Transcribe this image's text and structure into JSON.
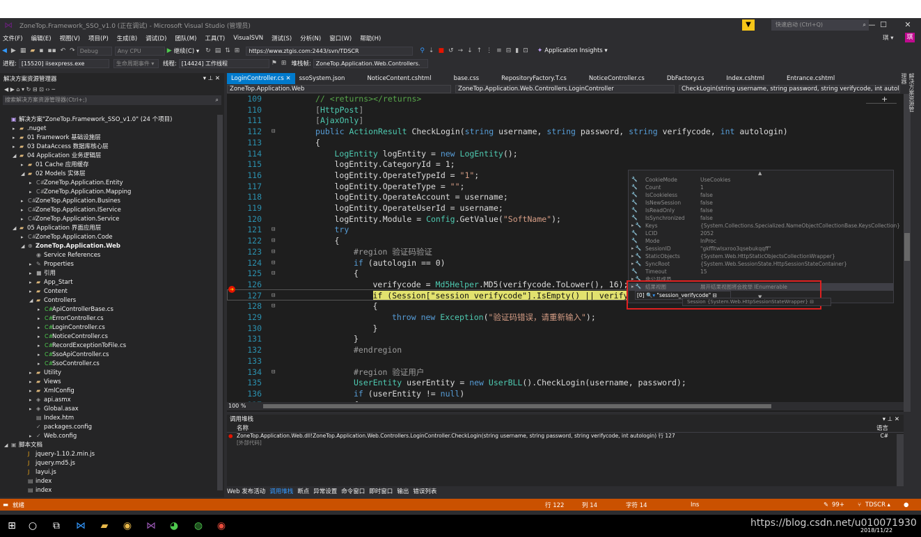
{
  "window": {
    "title": "ZoneTop.Framework_SSO_v1.0 (正在调试) - Microsoft Visual Studio (管理员)",
    "min": "—",
    "max": "☐",
    "close": "✕"
  },
  "quick_launch": {
    "placeholder": "快速启动 (Ctrl+Q)"
  },
  "user": {
    "name": "琪 ▾",
    "avatar": "琪"
  },
  "menu": [
    "文件(F)",
    "编辑(E)",
    "视图(V)",
    "项目(P)",
    "生成(B)",
    "调试(D)",
    "团队(M)",
    "工具(T)",
    "VisualSVN",
    "测试(S)",
    "分析(N)",
    "窗口(W)",
    "帮助(H)"
  ],
  "toolbar": {
    "config": "Debug",
    "platform": "Any CPU",
    "continue": "继续(C) ▾",
    "url": "https://www.ztgis.com:2443/svn/TDSCR",
    "insights": "Application Insights ▾"
  },
  "toolbar2": {
    "process_label": "进程:",
    "process": "[15520] iisexpress.exe",
    "lifecycle": "生命周期事件 ▾",
    "thread_label": "线程:",
    "thread": "[14424] 工作线程",
    "stack_label": "堆栈帧:",
    "stack": "ZoneTop.Application.Web.Controllers."
  },
  "solution": {
    "header": "解决方案资源管理器",
    "search": "搜索解决方案资源管理器(Ctrl+;)",
    "items": [
      {
        "label": "解决方案\"ZoneTop.Framework_SSO_v1.0\" (24 个项目)",
        "indent": 0,
        "icon": "▣",
        "arrow": "",
        "color": "#c5a5ff"
      },
      {
        "label": ".nuget",
        "indent": 1,
        "icon": "▰",
        "arrow": "▸",
        "color": "#dcb67a"
      },
      {
        "label": "01 Framework 基础设施层",
        "indent": 1,
        "icon": "▰",
        "arrow": "▸",
        "color": "#dcb67a"
      },
      {
        "label": "03 DataAccess 数据库核心层",
        "indent": 1,
        "icon": "▰",
        "arrow": "▸",
        "color": "#dcb67a"
      },
      {
        "label": "04 Application 业务逻辑层",
        "indent": 1,
        "icon": "▰",
        "arrow": "◢",
        "color": "#dcb67a"
      },
      {
        "label": "01 Cache 应用缓存",
        "indent": 2,
        "icon": "▰",
        "arrow": "▸",
        "color": "#dcb67a"
      },
      {
        "label": "02 Models 实体层",
        "indent": 2,
        "icon": "▰",
        "arrow": "◢",
        "color": "#dcb67a"
      },
      {
        "label": "ZoneTop.Application.Entity",
        "indent": 3,
        "icon": "C#",
        "arrow": "▸",
        "color": "#9b9b9b"
      },
      {
        "label": "ZoneTop.Application.Mapping",
        "indent": 3,
        "icon": "C#",
        "arrow": "▸",
        "color": "#9b9b9b"
      },
      {
        "label": "ZoneTop.Application.Busines",
        "indent": 2,
        "icon": "C#",
        "arrow": "▸",
        "color": "#9b9b9b"
      },
      {
        "label": "ZoneTop.Application.IService",
        "indent": 2,
        "icon": "C#",
        "arrow": "▸",
        "color": "#9b9b9b"
      },
      {
        "label": "ZoneTop.Application.Service",
        "indent": 2,
        "icon": "C#",
        "arrow": "▸",
        "color": "#9b9b9b"
      },
      {
        "label": "05 Application 界面应用层",
        "indent": 1,
        "icon": "▰",
        "arrow": "◢",
        "color": "#dcb67a"
      },
      {
        "label": "ZoneTop.Application.Code",
        "indent": 2,
        "icon": "C#",
        "arrow": "▸",
        "color": "#9b9b9b"
      },
      {
        "label": "ZoneTop.Application.Web",
        "indent": 2,
        "icon": "⊕",
        "arrow": "◢",
        "color": "#9b9b9b",
        "bold": true
      },
      {
        "label": "Service References",
        "indent": 3,
        "icon": "◉",
        "arrow": "",
        "color": "#9b9b9b"
      },
      {
        "label": "Properties",
        "indent": 3,
        "icon": "✎",
        "arrow": "▸",
        "color": "#9b9b9b"
      },
      {
        "label": "引用",
        "indent": 3,
        "icon": "■",
        "arrow": "▸",
        "color": "#9b9b9b"
      },
      {
        "label": "App_Start",
        "indent": 3,
        "icon": "▰",
        "arrow": "▸",
        "color": "#dcb67a"
      },
      {
        "label": "Content",
        "indent": 3,
        "icon": "▰",
        "arrow": "▸",
        "color": "#dcb67a"
      },
      {
        "label": "Controllers",
        "indent": 3,
        "icon": "▰",
        "arrow": "◢",
        "color": "#dcb67a"
      },
      {
        "label": "ApiControllerBase.cs",
        "indent": 4,
        "icon": "C#",
        "arrow": "▸",
        "color": "#4ec94e"
      },
      {
        "label": "ErrorController.cs",
        "indent": 4,
        "icon": "C#",
        "arrow": "▸",
        "color": "#4ec94e"
      },
      {
        "label": "LoginController.cs",
        "indent": 4,
        "icon": "C#",
        "arrow": "▸",
        "color": "#4ec94e"
      },
      {
        "label": "NoticeController.cs",
        "indent": 4,
        "icon": "C#",
        "arrow": "▸",
        "color": "#4ec94e"
      },
      {
        "label": "RecordExceptionToFile.cs",
        "indent": 4,
        "icon": "C#",
        "arrow": "▸",
        "color": "#4ec94e"
      },
      {
        "label": "SsoApiController.cs",
        "indent": 4,
        "icon": "C#",
        "arrow": "▸",
        "color": "#4ec94e"
      },
      {
        "label": "SsoController.cs",
        "indent": 4,
        "icon": "C#",
        "arrow": "▸",
        "color": "#4ec94e"
      },
      {
        "label": "Utility",
        "indent": 3,
        "icon": "▰",
        "arrow": "▸",
        "color": "#dcb67a"
      },
      {
        "label": "Views",
        "indent": 3,
        "icon": "▰",
        "arrow": "▸",
        "color": "#dcb67a"
      },
      {
        "label": "XmlConfig",
        "indent": 3,
        "icon": "▰",
        "arrow": "▸",
        "color": "#dcb67a"
      },
      {
        "label": "api.asmx",
        "indent": 3,
        "icon": "◈",
        "arrow": "▸",
        "color": "#9b9b9b"
      },
      {
        "label": "Global.asax",
        "indent": 3,
        "icon": "◈",
        "arrow": "▸",
        "color": "#9b9b9b"
      },
      {
        "label": "Index.htm",
        "indent": 3,
        "icon": "▤",
        "arrow": "",
        "color": "#9b9b9b"
      },
      {
        "label": "packages.config",
        "indent": 3,
        "icon": "✓",
        "arrow": "",
        "color": "#9b9b9b"
      },
      {
        "label": "Web.config",
        "indent": 3,
        "icon": "✓",
        "arrow": "▸",
        "color": "#9b9b9b"
      },
      {
        "label": "脚本文档",
        "indent": 0,
        "icon": "▣",
        "arrow": "◢",
        "color": "#9b9b9b"
      },
      {
        "label": "jquery-1.10.2.min.js",
        "indent": 2,
        "icon": "J",
        "arrow": "",
        "color": "#e8a317"
      },
      {
        "label": "jquery.md5.js",
        "indent": 2,
        "icon": "J",
        "arrow": "",
        "color": "#e8a317"
      },
      {
        "label": "layui.js",
        "indent": 2,
        "icon": "J",
        "arrow": "",
        "color": "#e8a317"
      },
      {
        "label": "index",
        "indent": 2,
        "icon": "▤",
        "arrow": "",
        "color": "#9b9b9b"
      },
      {
        "label": "index",
        "indent": 2,
        "icon": "▤",
        "arrow": "",
        "color": "#9b9b9b"
      }
    ]
  },
  "tabs": [
    "LoginController.cs",
    "ssoSystem.json",
    "NoticeContent.cshtml",
    "base.css",
    "RepositoryFactory.T.cs",
    "NoticeController.cs",
    "DbFactory.cs",
    "Index.cshtml",
    "Entrance.cshtml"
  ],
  "tab_close": "✕",
  "nav": {
    "project": "ZoneTop.Application.Web",
    "class": "ZoneTop.Application.Web.Controllers.LoginController",
    "member": "CheckLogin(string username, string password, string verifycode, int autolo"
  },
  "code": [
    {
      "n": "109",
      "html": "<span class='c'>// &lt;returns&gt;&lt;/returns&gt;</span>",
      "i": 0
    },
    {
      "n": "110",
      "html": "<span class='p'>[</span><span class='a'>HttpPost</span><span class='p'>]</span>",
      "i": 0
    },
    {
      "n": "111",
      "html": "<span class='p'>[</span><span class='a'>AjaxOnly</span><span class='p'>]</span>",
      "i": 0
    },
    {
      "n": "112",
      "html": "<span class='k'>public</span> <span class='t'>ActionResult</span> CheckLogin(<span class='k'>string</span> username, <span class='k'>string</span> password, <span class='k'>string</span> verifycode, <span class='k'>int</span> autologin)",
      "i": 0
    },
    {
      "n": "113",
      "html": "{",
      "i": 0
    },
    {
      "n": "114",
      "html": "<span class='t'>LogEntity</span> logEntity = <span class='k'>new</span> <span class='t'>LogEntity</span>();",
      "i": 1
    },
    {
      "n": "115",
      "html": "logEntity.CategoryId = 1;",
      "i": 1
    },
    {
      "n": "116",
      "html": "logEntity.OperateTypeId = <span class='s'>\"1\"</span>;",
      "i": 1
    },
    {
      "n": "117",
      "html": "logEntity.OperateType = <span class='s'>\"\"</span>;",
      "i": 1
    },
    {
      "n": "118",
      "html": "logEntity.OperateAccount = username;",
      "i": 1
    },
    {
      "n": "119",
      "html": "logEntity.OperateUserId = username;",
      "i": 1
    },
    {
      "n": "120",
      "html": "logEntity.Module = <span class='t'>Config</span>.GetValue(<span class='s'>\"SoftName\"</span>);",
      "i": 1
    },
    {
      "n": "121",
      "html": "<span class='k'>try</span>",
      "i": 1
    },
    {
      "n": "122",
      "html": "{",
      "i": 1
    },
    {
      "n": "123",
      "html": "<span class='p'>#region 验证码验证</span>",
      "i": 2
    },
    {
      "n": "124",
      "html": "<span class='k'>if</span> (autologin == 0)",
      "i": 2
    },
    {
      "n": "125",
      "html": "{",
      "i": 2
    },
    {
      "n": "126",
      "html": "verifycode = <span class='t'>Md5Helper</span>.MD5(verifycode.ToLower(), 16);",
      "i": 3
    },
    {
      "n": "127",
      "html": "<span style='background:#e2e26e;color:#111'>if (Session[\"session_verifycode\"].IsEmpty() || verify</span>",
      "i": 3
    },
    {
      "n": "128",
      "html": "{",
      "i": 3
    },
    {
      "n": "129",
      "html": "<span class='k'>throw</span> <span class='k'>new</span> <span class='t'>Exception</span>(<span class='s'>\"验证码错误，请重新输入\"</span>);",
      "i": 4
    },
    {
      "n": "130",
      "html": "}",
      "i": 3
    },
    {
      "n": "131",
      "html": "}",
      "i": 2
    },
    {
      "n": "132",
      "html": "<span class='p'>#endregion</span>",
      "i": 2
    },
    {
      "n": "133",
      "html": "",
      "i": 2
    },
    {
      "n": "134",
      "html": "<span class='p'>#region 验证用户</span>",
      "i": 2
    },
    {
      "n": "135",
      "html": "<span class='t'>UserEntity</span> userEntity = <span class='k'>new</span> <span class='t'>UserBLL</span>().CheckLogin(username, password);",
      "i": 2
    },
    {
      "n": "136",
      "html": "<span class='k'>if</span> (userEntity != <span class='k'>null</span>)",
      "i": 2
    },
    {
      "n": "137",
      "html": "{",
      "i": 2
    }
  ],
  "datatip": [
    {
      "name": "CookieMode",
      "value": "UseCookies"
    },
    {
      "name": "Count",
      "value": "1"
    },
    {
      "name": "IsCookieless",
      "value": "false"
    },
    {
      "name": "IsNewSession",
      "value": "false"
    },
    {
      "name": "IsReadOnly",
      "value": "false"
    },
    {
      "name": "IsSynchronized",
      "value": "false"
    },
    {
      "name": "Keys",
      "value": "{System.Collections.Specialized.NameObjectCollectionBase.KeysCollection}"
    },
    {
      "name": "LCID",
      "value": "2052"
    },
    {
      "name": "Mode",
      "value": "InProc"
    },
    {
      "name": "SessionID",
      "value": "\"gkffltwlsxroo3qsebukqqff\""
    },
    {
      "name": "StaticObjects",
      "value": "{System.Web.HttpStaticObjectsCollectionWrapper}"
    },
    {
      "name": "SyncRoot",
      "value": "{System.Web.SessionState.HttpSessionStateContainer}"
    },
    {
      "name": "Timeout",
      "value": "15"
    },
    {
      "name": "非公共成员",
      "value": ""
    },
    {
      "name": "结果视图",
      "value": "展开结果视图将会枚举 IEnumerable"
    }
  ],
  "subtip": {
    "index": "[0]",
    "value": "\"session_verifycode\"",
    "session": "Session",
    "session_val": "{System.Web.HttpSessionStateWrapper}"
  },
  "zoom": "100 %",
  "callstack": {
    "header": "调用堆栈",
    "col_name": "名称",
    "col_lang": "语言",
    "rows": [
      {
        "name": "ZoneTop.Application.Web.dll!ZoneTop.Application.Web.Controllers.LoginController.CheckLogin(string username, string password, string verifycode, int autologin) 行 127",
        "lang": "C#"
      },
      {
        "name": "[外部代码]",
        "lang": ""
      }
    ]
  },
  "bottom_tabs": [
    "Web 发布活动",
    "调用堆栈",
    "断点",
    "异常设置",
    "命令窗口",
    "即时窗口",
    "输出",
    "错误列表"
  ],
  "right_rail": "解决方案资源管理器",
  "status": {
    "ready": "就绪",
    "line": "行 122",
    "col": "列 14",
    "char": "字符 14",
    "ins": "Ins",
    "errors": "99+",
    "branch": "TDSCR ▴"
  },
  "taskbar": {
    "url": "https://blog.csdn.net/u010071930",
    "date": "2018/11/22"
  }
}
